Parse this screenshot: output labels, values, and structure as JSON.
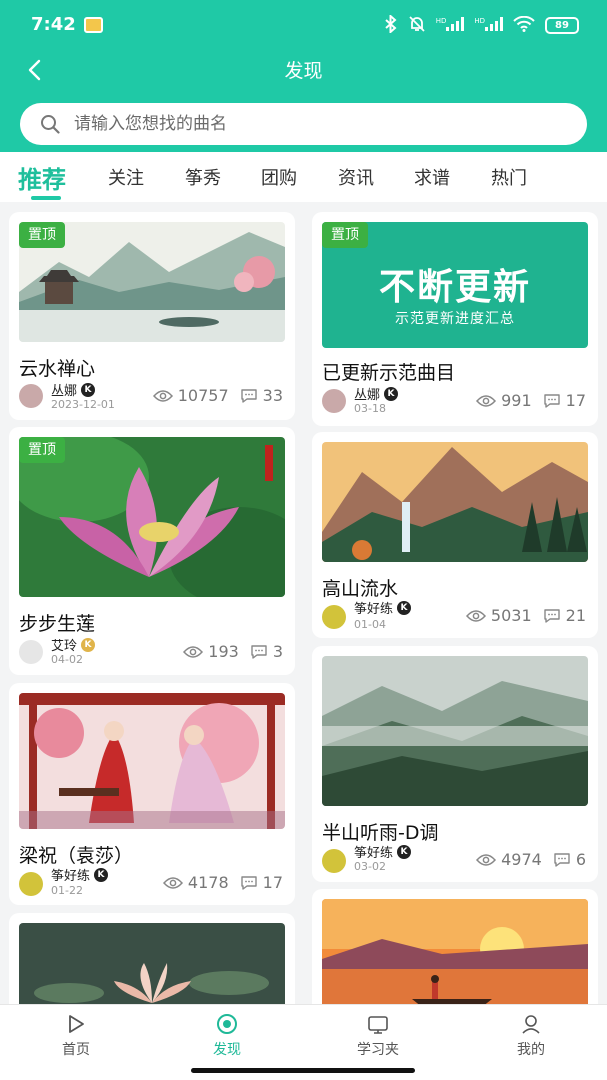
{
  "status": {
    "time": "7:42",
    "battery": "89",
    "hd1": "HD",
    "hd2": "HD"
  },
  "nav": {
    "title": "发现"
  },
  "search": {
    "placeholder": "请输入您想找的曲名"
  },
  "tabs": [
    {
      "label": "推荐",
      "active": true
    },
    {
      "label": "关注"
    },
    {
      "label": "筝秀"
    },
    {
      "label": "团购"
    },
    {
      "label": "资讯"
    },
    {
      "label": "求谱"
    },
    {
      "label": "热门"
    }
  ],
  "cards": [
    {
      "title": "云水禅心",
      "author": "丛娜",
      "date": "2023-12-01",
      "views": "10757",
      "comments": "33",
      "pinned": true,
      "image": "misty-landscape-pavilion"
    },
    {
      "title": "已更新示范曲目",
      "author": "丛娜",
      "date": "03-18",
      "views": "991",
      "comments": "17",
      "pinned": true,
      "banner_main": "不断更新",
      "banner_sub": "示范更新进度汇总"
    },
    {
      "title": "步步生莲",
      "author": "艾玲",
      "date": "04-02",
      "views": "193",
      "comments": "3",
      "pinned": true,
      "image": "pink-lotus-flower"
    },
    {
      "title": "高山流水",
      "author": "筝好练",
      "date": "01-04",
      "views": "5031",
      "comments": "21",
      "image": "mountain-waterfall"
    },
    {
      "title": "梁祝（袁莎）",
      "author": "筝好练",
      "date": "01-22",
      "views": "4178",
      "comments": "17",
      "image": "couple-in-pavilion"
    },
    {
      "title": "半山听雨-D调",
      "author": "筝好练",
      "date": "03-02",
      "views": "4974",
      "comments": "6",
      "image": "misty-forest-mountains"
    },
    {
      "image": "lotus-pond"
    },
    {
      "image": "sunset-boat"
    }
  ],
  "pin_label": "置顶",
  "bottom_nav": [
    {
      "label": "首页",
      "icon": "play-icon"
    },
    {
      "label": "发现",
      "icon": "discover-icon",
      "active": true
    },
    {
      "label": "学习夹",
      "icon": "folder-icon"
    },
    {
      "label": "我的",
      "icon": "user-icon"
    }
  ],
  "colors": {
    "accent": "#1fc9a6",
    "pin": "#3cb043",
    "active_tab": "#1fbf9c"
  }
}
